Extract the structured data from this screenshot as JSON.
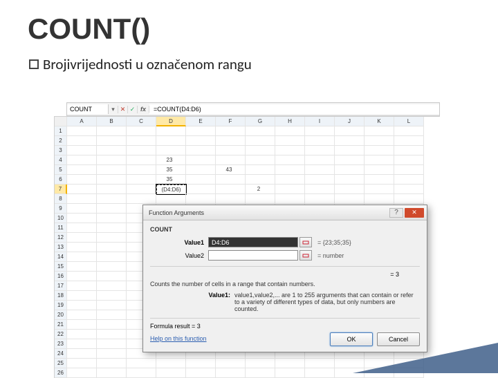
{
  "title": "COUNT()",
  "bullet_prefix": "Broji",
  "bullet_rest": " vrijednosti u označenom rangu",
  "formula_bar": {
    "name_box": "COUNT",
    "formula": "=COUNT(D4:D6)"
  },
  "columns": [
    "A",
    "B",
    "C",
    "D",
    "E",
    "F",
    "G",
    "H",
    "I",
    "J",
    "K",
    "L"
  ],
  "selected_col": "D",
  "selected_row": 7,
  "cells": {
    "D4": "23",
    "D5": "35",
    "D6": "35",
    "D7": "(D4:D6)",
    "F5": "43",
    "G6": "",
    "G7": "2"
  },
  "dialog": {
    "title": "Function Arguments",
    "fn": "COUNT",
    "arg1_label": "Value1",
    "arg1_value": "D4:D6",
    "arg1_result": "= {23;35;35}",
    "arg2_label": "Value2",
    "arg2_placeholder": "",
    "arg2_result": "= number",
    "equals": "= 3",
    "desc": "Counts the number of cells in a range that contain numbers.",
    "arg_name": "Value1:",
    "arg_desc": "value1,value2,... are 1 to 255 arguments that can contain or refer to a variety of different types of data, but only numbers are counted.",
    "formula_result_label": "Formula result =",
    "formula_result_value": " 3",
    "help": "Help on this function",
    "ok": "OK",
    "cancel": "Cancel"
  }
}
